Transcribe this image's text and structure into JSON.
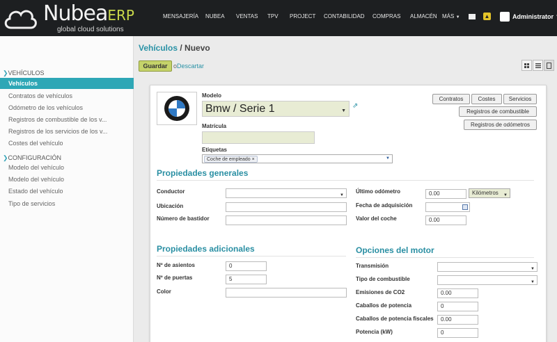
{
  "brand": {
    "name": "Nubea",
    "suffix": "ERP",
    "tagline": "global cloud solutions"
  },
  "nav": [
    "MENSAJERÍA",
    "NUBEA",
    "VENTAS",
    "TPV",
    "PROJECT",
    "CONTABILIDAD",
    "COMPRAS",
    "ALMACÉN",
    "MÁS"
  ],
  "user": {
    "name": "Administrator"
  },
  "sidebar": {
    "section1": "VEHÍCULOS",
    "items1": [
      "Vehículos",
      "Contratos de vehículos",
      "Odómetro de los vehículos",
      "Registros de combustible de los v...",
      "Registros de los servicios de los v...",
      "Costes del vehículo"
    ],
    "section2": "CONFIGURACIÓN",
    "items2": [
      "Modelo del vehículo",
      "Modelo del vehículo",
      "Estado del vehículo",
      "Tipo de servicios"
    ]
  },
  "breadcrumb": {
    "parent": "Vehículos",
    "separator": " / ",
    "current": "Nuevo"
  },
  "actions": {
    "save": "Guardar",
    "or": "o",
    "discard": "Descartar"
  },
  "smart_buttons": {
    "contracts": "Contratos",
    "costs": "Costes",
    "services": "Servicios",
    "fuel": "Registros de combustible",
    "odometer": "Registros de odómetros"
  },
  "form": {
    "model_label": "Modelo",
    "model_value": "Bmw / Serie 1",
    "plate_label": "Matrícula",
    "tags_label": "Etiquetas",
    "tag": "Coche de empleado",
    "general_title": "Propiedades generales",
    "driver_label": "Conductor",
    "location_label": "Ubicación",
    "chassis_label": "Número de bastidor",
    "odometer_label": "Último odómetro",
    "odometer_value": "0.00",
    "odometer_unit": "Kilómetros",
    "acquisition_label": "Fecha de adquisición",
    "car_value_label": "Valor del coche",
    "car_value": "0.00",
    "extra_title": "Propiedades adicionales",
    "seats_label": "Nº de asientos",
    "seats_value": "0",
    "doors_label": "Nº de puertas",
    "doors_value": "5",
    "color_label": "Color",
    "engine_title": "Opciones del motor",
    "transmission_label": "Transmisión",
    "fuel_type_label": "Tipo de combustible",
    "co2_label": "Emisiones de CO2",
    "co2_value": "0.00",
    "horsepower_label": "Caballos de potencia",
    "horsepower_value": "0",
    "fiscal_hp_label": "Caballos de potencia fiscales",
    "fiscal_hp_value": "0.00",
    "power_label": "Potencia (kW)",
    "power_value": "0"
  },
  "colors": {
    "accent": "#2ea7b6",
    "topbar": "#1d1f21",
    "save": "#c5d36a"
  }
}
